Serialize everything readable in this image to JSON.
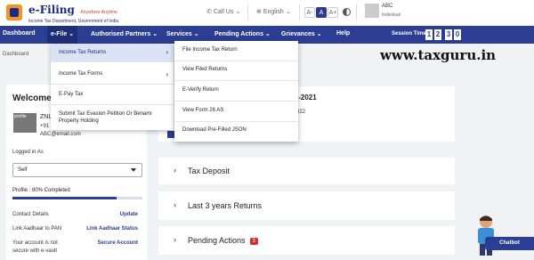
{
  "header": {
    "brand_main": "e-Filing",
    "brand_tagline": "Anywhere Anytime",
    "brand_sub": "Income Tax Department, Government of India",
    "call_us": "Call Us",
    "language": "English",
    "font_small": "A-",
    "font_normal": "A",
    "font_large": "A+",
    "user_name": "ABC",
    "user_role": "Individual"
  },
  "nav": {
    "items": [
      "Dashboard",
      "e-File",
      "Authorised Partners",
      "Services",
      "Pending Actions",
      "Grievances",
      "Help"
    ],
    "session_label": "Session Time",
    "session_digits": [
      "1",
      "2",
      "3",
      "0"
    ]
  },
  "breadcrumb": "Dashboard",
  "watermark": "www.taxguru.in",
  "efile_menu": {
    "items": [
      "Income Tax Returns",
      "Income Tax Forms",
      "E-Pay Tax",
      "Submit Tax Evasion Petition Or Benami",
      "Property Holding"
    ],
    "arrow": "›"
  },
  "returns_submenu": {
    "items": [
      "File Income Tax Return",
      "View Filed Returns",
      "E-Verify Return",
      "View Form 26 AS",
      "Download Pre-Filled JSON"
    ]
  },
  "profile": {
    "welcome": "Welcome B",
    "pic_text": "profile",
    "name_frag": "ZNL",
    "phone": "+91",
    "email": "ABC@email.com",
    "logged_in_as_label": "Logged in As",
    "logged_in_as_value": "Self",
    "completion_label": "Profile : 80% Completed",
    "completion_fraction": 0.8,
    "rows": [
      {
        "label": "Contact Details",
        "action": "Update"
      },
      {
        "label": "Link Aadhaar to PAN",
        "action": "Link Aadhaar Status"
      },
      {
        "label": "Your account is not",
        "action": "Secure Account"
      },
      {
        "label": "secure with e-vault",
        "action": ""
      }
    ]
  },
  "cards": {
    "top_date": "Mar-2021",
    "top_frag": "022",
    "tax_deposit": "Tax Deposit",
    "last_3_years": "Last 3 years Returns",
    "pending_actions": "Pending Actions",
    "pending_count": "3",
    "chevron": "›"
  },
  "chatbot": "Chatbot"
}
